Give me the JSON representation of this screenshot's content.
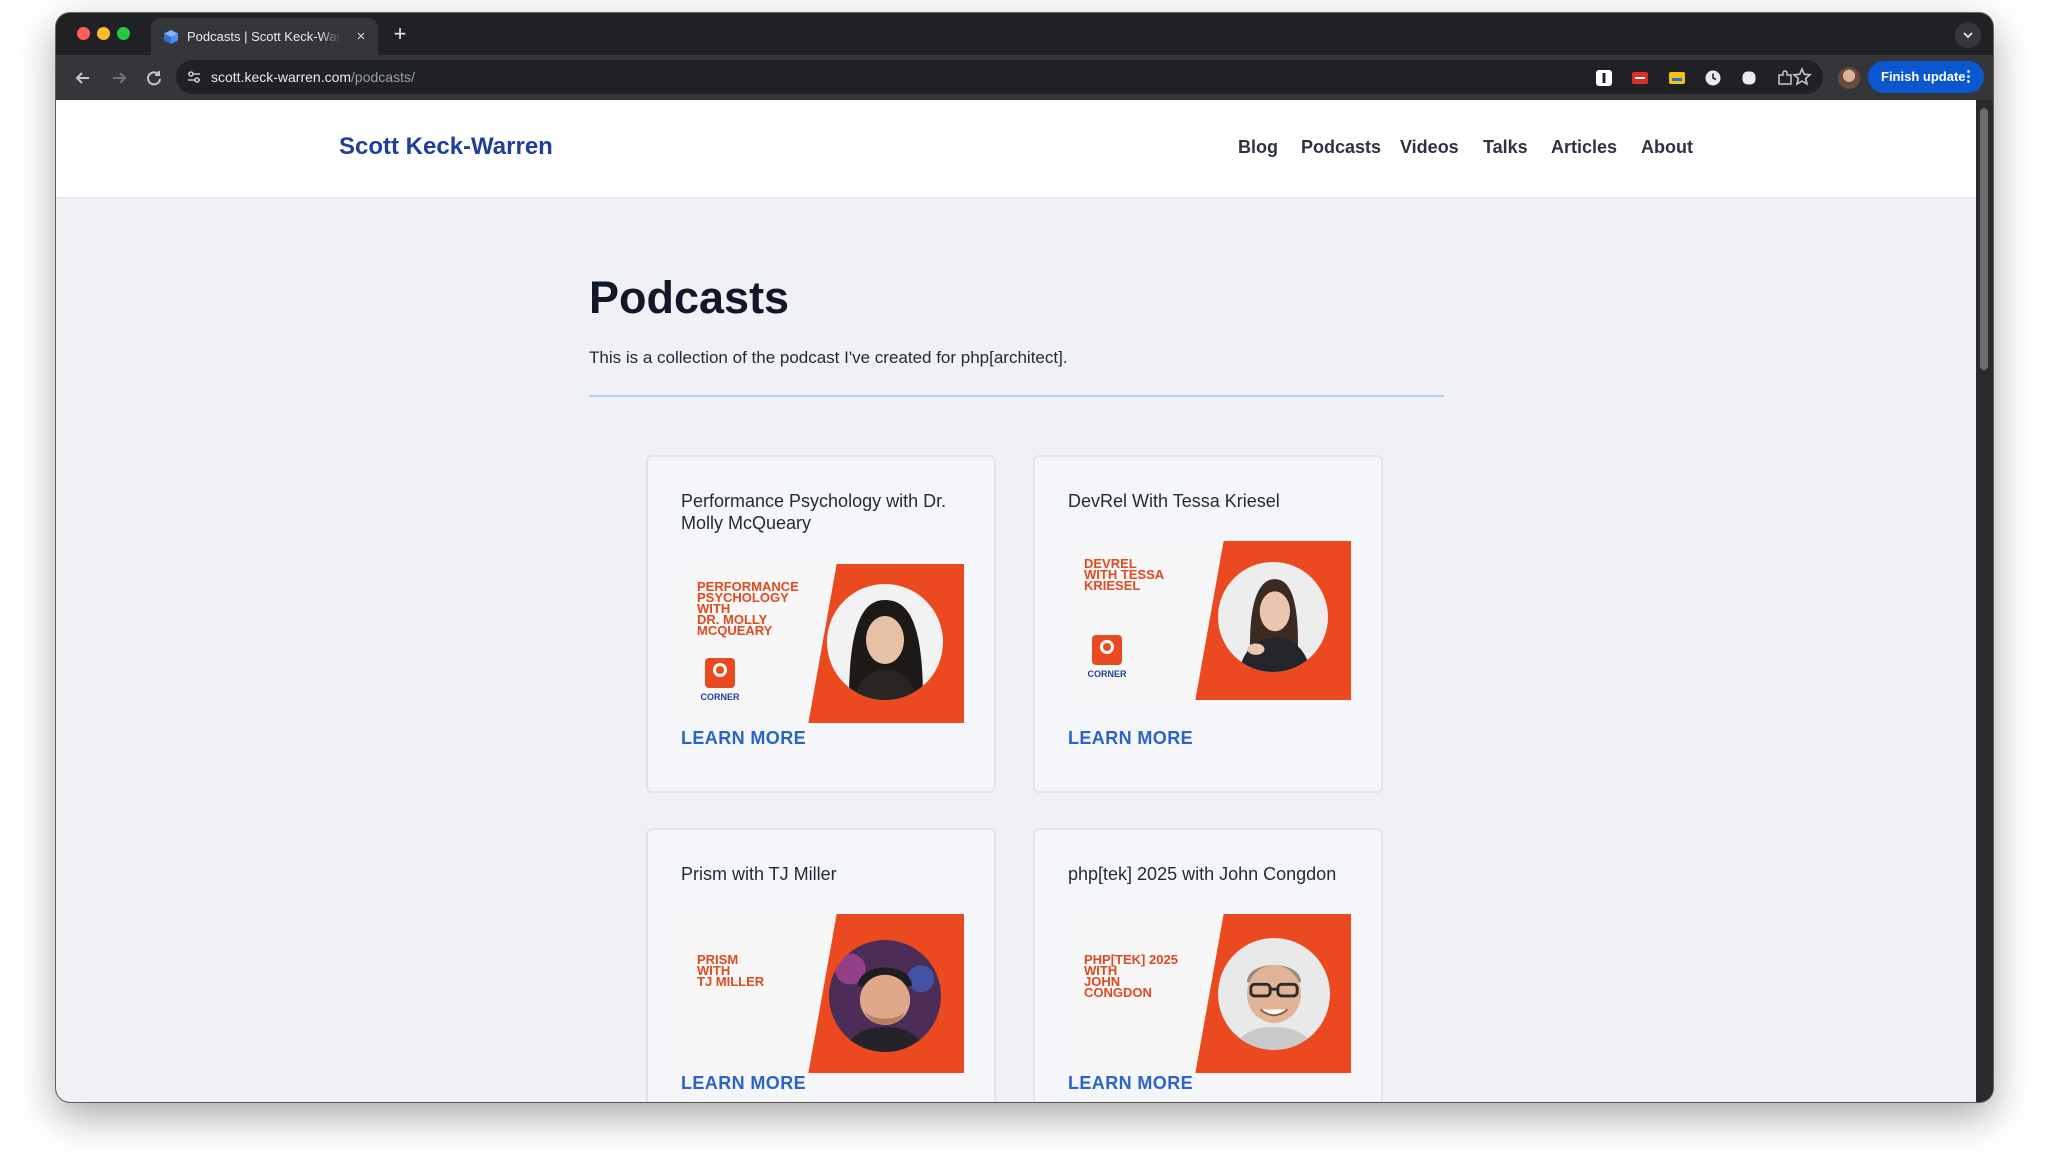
{
  "browser": {
    "tab_title": "Podcasts | Scott Keck-Warren",
    "tab_close": "×",
    "new_tab": "+",
    "url_host": "scott.keck-warren.com",
    "url_path": "/podcasts/",
    "finish_update": "Finish update",
    "menu_dots": "⋮"
  },
  "site": {
    "title": "Scott Keck-Warren",
    "nav": [
      "Blog",
      "Podcasts",
      "Videos",
      "Talks",
      "Articles",
      "About"
    ]
  },
  "page": {
    "heading": "Podcasts",
    "intro": "This is a collection of the podcast I've created for php[architect]."
  },
  "cards": [
    {
      "title": "Performance Psychology with Dr. Molly McQueary",
      "image_text": [
        "PERFORMANCE",
        "PSYCHOLOGY",
        "WITH",
        "DR. MOLLY",
        "MCQUEARY"
      ],
      "logo_text": "CORNER",
      "link": "LEARN MORE"
    },
    {
      "title": "DevRel With Tessa Kriesel",
      "image_text": [
        "DEVREL",
        "WITH TESSA",
        "KRIESEL"
      ],
      "logo_text": "CORNER",
      "link": "LEARN MORE"
    },
    {
      "title": "Prism with TJ Miller",
      "image_text": [
        "PRISM",
        "WITH",
        "TJ MILLER"
      ],
      "link": "LEARN MORE"
    },
    {
      "title": "php[tek] 2025 with John Congdon",
      "image_text": [
        "PHP[TEK] 2025",
        "WITH",
        "JOHN",
        "CONGDON"
      ],
      "link": "LEARN MORE"
    }
  ],
  "colors": {
    "accent_blue": "#1f3f9a",
    "link_blue": "#2a64c7",
    "card_orange": "#eb4a21",
    "update_button": "#0b57d0"
  },
  "icons": [
    "back-arrow-icon",
    "forward-arrow-icon",
    "reload-icon",
    "site-settings-icon",
    "bookmark-star-icon",
    "extensions-puzzle-icon",
    "profile-avatar"
  ]
}
